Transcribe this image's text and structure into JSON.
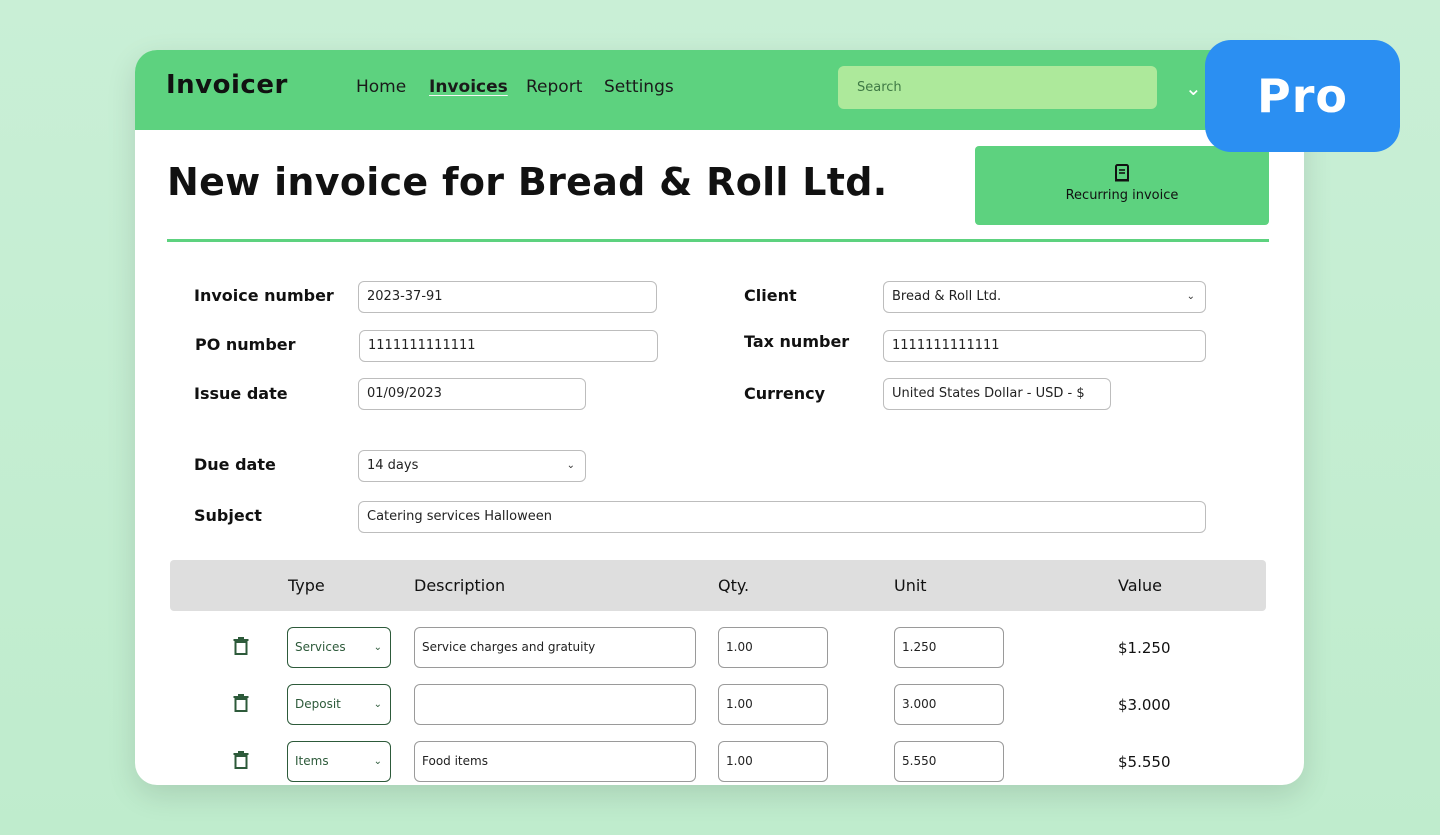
{
  "app": {
    "brand": "Invoicer"
  },
  "nav": [
    {
      "label": "Home"
    },
    {
      "label": "Invoices"
    },
    {
      "label": "Report"
    },
    {
      "label": "Settings"
    }
  ],
  "search": {
    "placeholder": "Search"
  },
  "badge": {
    "label": "Pro"
  },
  "page": {
    "title": "New invoice for Bread & Roll Ltd.",
    "recurring_label": "Recurring invoice"
  },
  "form": {
    "invoice_number": {
      "label": "Invoice number",
      "value": "2023-37-91"
    },
    "po_number": {
      "label": "PO number",
      "value": "1111111111111"
    },
    "issue_date": {
      "label": "Issue date",
      "value": "01/09/2023"
    },
    "due_date": {
      "label": "Due date",
      "value": "14 days"
    },
    "subject": {
      "label": "Subject",
      "value": "Catering services Halloween"
    },
    "client": {
      "label": "Client",
      "value": "Bread & Roll Ltd."
    },
    "tax_number": {
      "label": "Tax number",
      "value": "1111111111111"
    },
    "currency": {
      "label": "Currency",
      "value": "United States Dollar - USD - $"
    }
  },
  "table": {
    "headers": {
      "type": "Type",
      "description": "Description",
      "qty": "Qty.",
      "unit": "Unit",
      "value": "Value"
    },
    "rows": [
      {
        "type": "Services",
        "description": "Service charges and gratuity",
        "qty": "1.00",
        "unit": "1.250",
        "value": "$1.250"
      },
      {
        "type": "Deposit",
        "description": "",
        "qty": "1.00",
        "unit": "3.000",
        "value": "$3.000"
      },
      {
        "type": "Items",
        "description": "Food items",
        "qty": "1.00",
        "unit": "5.550",
        "value": "$5.550"
      }
    ]
  },
  "colors": {
    "accent_green": "#5dd27f",
    "badge_blue": "#2b8ff2",
    "search_green": "#ade99b"
  }
}
